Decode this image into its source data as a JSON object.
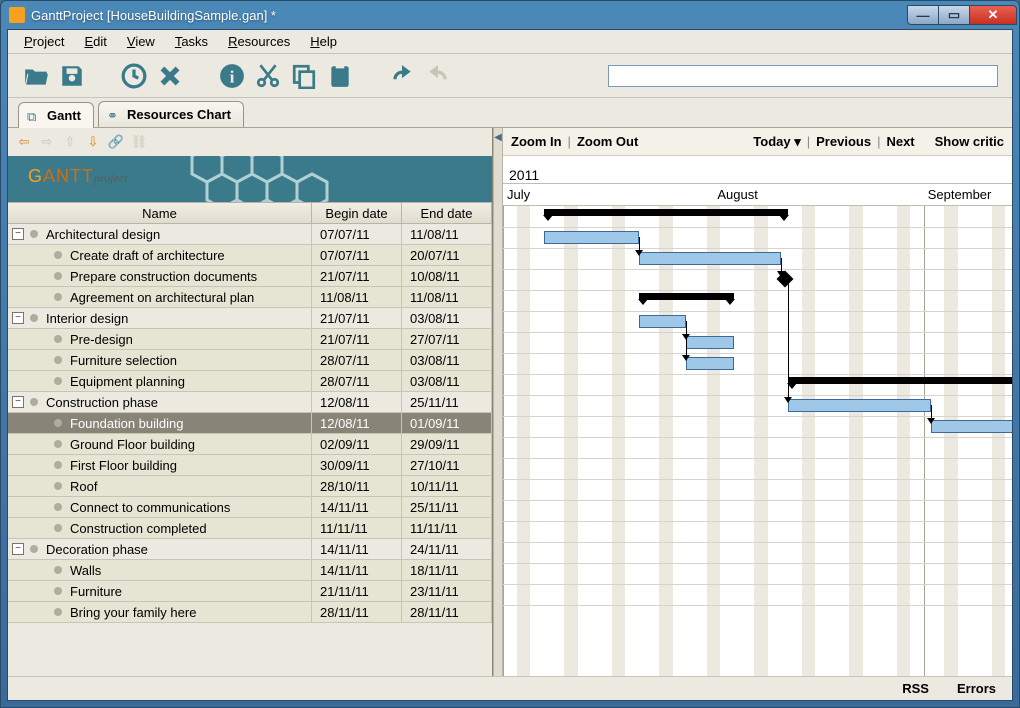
{
  "window": {
    "title": "GanttProject [HouseBuildingSample.gan] *"
  },
  "menu": {
    "project": "Project",
    "edit": "Edit",
    "view": "View",
    "tasks": "Tasks",
    "resources": "Resources",
    "help": "Help"
  },
  "tabs": {
    "gantt": "Gantt",
    "resources": "Resources Chart"
  },
  "columns": {
    "name": "Name",
    "begin": "Begin date",
    "end": "End date"
  },
  "toolbar_icons": [
    "open",
    "save",
    "clock",
    "delete",
    "info",
    "cut",
    "copy",
    "paste",
    "undo",
    "redo"
  ],
  "chart_toolbar": {
    "zoom_in": "Zoom In",
    "zoom_out": "Zoom Out",
    "today": "Today",
    "previous": "Previous",
    "next": "Next",
    "show_critical": "Show critical path"
  },
  "timeline": {
    "year": "2011",
    "months": [
      "July",
      "August",
      "September"
    ]
  },
  "status": {
    "rss": "RSS",
    "errors": "Errors"
  },
  "tasks": [
    {
      "id": 0,
      "indent": 0,
      "name": "Architectural design",
      "begin": "07/07/11",
      "end": "11/08/11",
      "summary": true,
      "expanded": true
    },
    {
      "id": 1,
      "indent": 1,
      "name": "Create draft of architecture",
      "begin": "07/07/11",
      "end": "20/07/11"
    },
    {
      "id": 2,
      "indent": 1,
      "name": "Prepare construction documents",
      "begin": "21/07/11",
      "end": "10/08/11"
    },
    {
      "id": 3,
      "indent": 1,
      "name": "Agreement on architectural plan",
      "begin": "11/08/11",
      "end": "11/08/11",
      "milestone": true
    },
    {
      "id": 4,
      "indent": 0,
      "name": "Interior design",
      "begin": "21/07/11",
      "end": "03/08/11",
      "summary": true,
      "expanded": true
    },
    {
      "id": 5,
      "indent": 1,
      "name": "Pre-design",
      "begin": "21/07/11",
      "end": "27/07/11"
    },
    {
      "id": 6,
      "indent": 1,
      "name": "Furniture selection",
      "begin": "28/07/11",
      "end": "03/08/11"
    },
    {
      "id": 7,
      "indent": 1,
      "name": "Equipment planning",
      "begin": "28/07/11",
      "end": "03/08/11"
    },
    {
      "id": 8,
      "indent": 0,
      "name": "Construction phase",
      "begin": "12/08/11",
      "end": "25/11/11",
      "summary": true,
      "expanded": true
    },
    {
      "id": 9,
      "indent": 1,
      "name": "Foundation building",
      "begin": "12/08/11",
      "end": "01/09/11",
      "selected": true
    },
    {
      "id": 10,
      "indent": 1,
      "name": "Ground Floor building",
      "begin": "02/09/11",
      "end": "29/09/11"
    },
    {
      "id": 11,
      "indent": 1,
      "name": "First Floor building",
      "begin": "30/09/11",
      "end": "27/10/11"
    },
    {
      "id": 12,
      "indent": 1,
      "name": "Roof",
      "begin": "28/10/11",
      "end": "10/11/11"
    },
    {
      "id": 13,
      "indent": 1,
      "name": "Connect to communications",
      "begin": "14/11/11",
      "end": "25/11/11"
    },
    {
      "id": 14,
      "indent": 1,
      "name": "Construction completed",
      "begin": "11/11/11",
      "end": "11/11/11"
    },
    {
      "id": 15,
      "indent": 0,
      "name": "Decoration phase",
      "begin": "14/11/11",
      "end": "24/11/11",
      "summary": true,
      "expanded": true
    },
    {
      "id": 16,
      "indent": 1,
      "name": "Walls",
      "begin": "14/11/11",
      "end": "18/11/11"
    },
    {
      "id": 17,
      "indent": 1,
      "name": "Furniture",
      "begin": "21/11/11",
      "end": "23/11/11"
    },
    {
      "id": 18,
      "indent": 1,
      "name": "Bring your family here",
      "begin": "28/11/11",
      "end": "28/11/11"
    }
  ],
  "chart_data": {
    "type": "gantt",
    "unit": "days",
    "axis_start": "2011-07-01",
    "axis_end": "2011-09-14",
    "bars": [
      {
        "row": 0,
        "kind": "summary",
        "start": "2011-07-07",
        "end": "2011-08-11"
      },
      {
        "row": 1,
        "kind": "task",
        "start": "2011-07-07",
        "end": "2011-07-20"
      },
      {
        "row": 2,
        "kind": "task",
        "start": "2011-07-21",
        "end": "2011-08-10"
      },
      {
        "row": 3,
        "kind": "milestone",
        "start": "2011-08-11"
      },
      {
        "row": 4,
        "kind": "summary",
        "start": "2011-07-21",
        "end": "2011-08-03"
      },
      {
        "row": 5,
        "kind": "task",
        "start": "2011-07-21",
        "end": "2011-07-27"
      },
      {
        "row": 6,
        "kind": "task",
        "start": "2011-07-28",
        "end": "2011-08-03"
      },
      {
        "row": 7,
        "kind": "task",
        "start": "2011-07-28",
        "end": "2011-08-03"
      },
      {
        "row": 8,
        "kind": "summary",
        "start": "2011-08-12",
        "end": "2011-11-25"
      },
      {
        "row": 9,
        "kind": "task",
        "start": "2011-08-12",
        "end": "2011-09-01"
      },
      {
        "row": 10,
        "kind": "task",
        "start": "2011-09-02",
        "end": "2011-09-29"
      }
    ],
    "dependencies": [
      [
        1,
        2
      ],
      [
        2,
        3
      ],
      [
        5,
        6
      ],
      [
        5,
        7
      ],
      [
        3,
        9
      ],
      [
        9,
        10
      ]
    ]
  }
}
